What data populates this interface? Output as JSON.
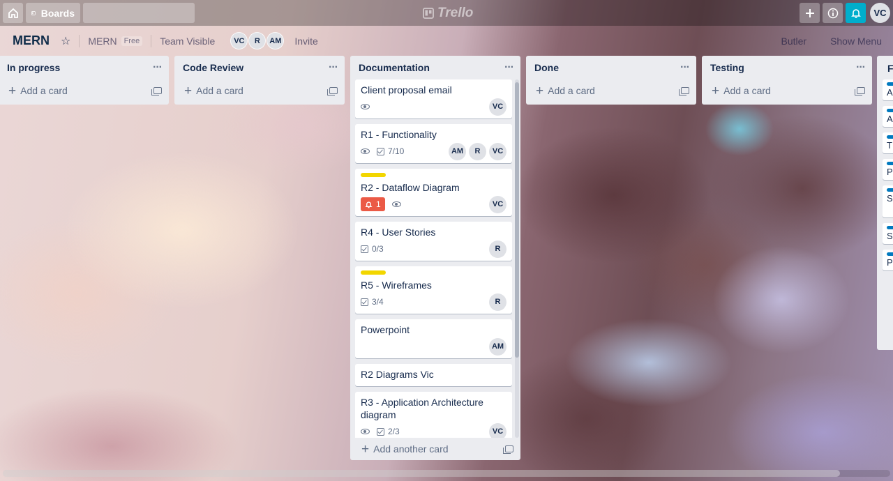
{
  "header": {
    "boards_label": "Boards",
    "search_value": "",
    "logo_text": "Trello",
    "user_initials": "VC"
  },
  "board": {
    "name": "MERN",
    "team_name": "MERN",
    "plan_badge": "Free",
    "visibility": "Team Visible",
    "members": [
      "VC",
      "R",
      "AM"
    ],
    "invite_label": "Invite",
    "butler_label": "Butler",
    "show_menu_label": "Show Menu"
  },
  "lists": [
    {
      "title": "In progress",
      "add_label": "Add a card"
    },
    {
      "title": "Code Review",
      "add_label": "Add a card"
    },
    {
      "title": "Documentation",
      "add_label": "Add another card"
    },
    {
      "title": "Done",
      "add_label": "Add a card"
    },
    {
      "title": "Testing",
      "add_label": "Add a card"
    },
    {
      "title": "F"
    }
  ],
  "documentation_cards": [
    {
      "title": "Client proposal email",
      "watch": true,
      "members": [
        "VC"
      ]
    },
    {
      "title": "R1 - Functionality",
      "watch": true,
      "checklist": "7/10",
      "members": [
        "AM",
        "R",
        "VC"
      ]
    },
    {
      "title": "R2 - Dataflow Diagram",
      "label": "yellow",
      "due_count": "1",
      "watch": true,
      "members": [
        "VC"
      ]
    },
    {
      "title": "R4 - User Stories",
      "checklist": "0/3",
      "members": [
        "R"
      ]
    },
    {
      "title": "R5 - Wireframes",
      "label": "yellow",
      "checklist": "3/4",
      "members": [
        "R"
      ]
    },
    {
      "title": "Powerpoint",
      "members": [
        "AM"
      ]
    },
    {
      "title": "R2 Diagrams Vic"
    },
    {
      "title": "R3 - Application Architecture diagram",
      "watch": true,
      "checklist": "2/3",
      "members": [
        "VC"
      ]
    }
  ],
  "partial_cards": [
    "A",
    "A",
    "T",
    "P",
    "S",
    "S",
    "P"
  ],
  "colors": {
    "label_yellow": "#f2d600",
    "due_red": "#eb5a46",
    "bell_button": "#00aecc",
    "list_bg": "#ebecf0"
  },
  "icons": [
    "home-icon",
    "boards-icon",
    "search-icon",
    "trello-logo-icon",
    "plus-icon",
    "info-icon",
    "bell-icon",
    "star-icon",
    "more-icon",
    "template-icon",
    "eye-icon",
    "checklist-icon"
  ]
}
